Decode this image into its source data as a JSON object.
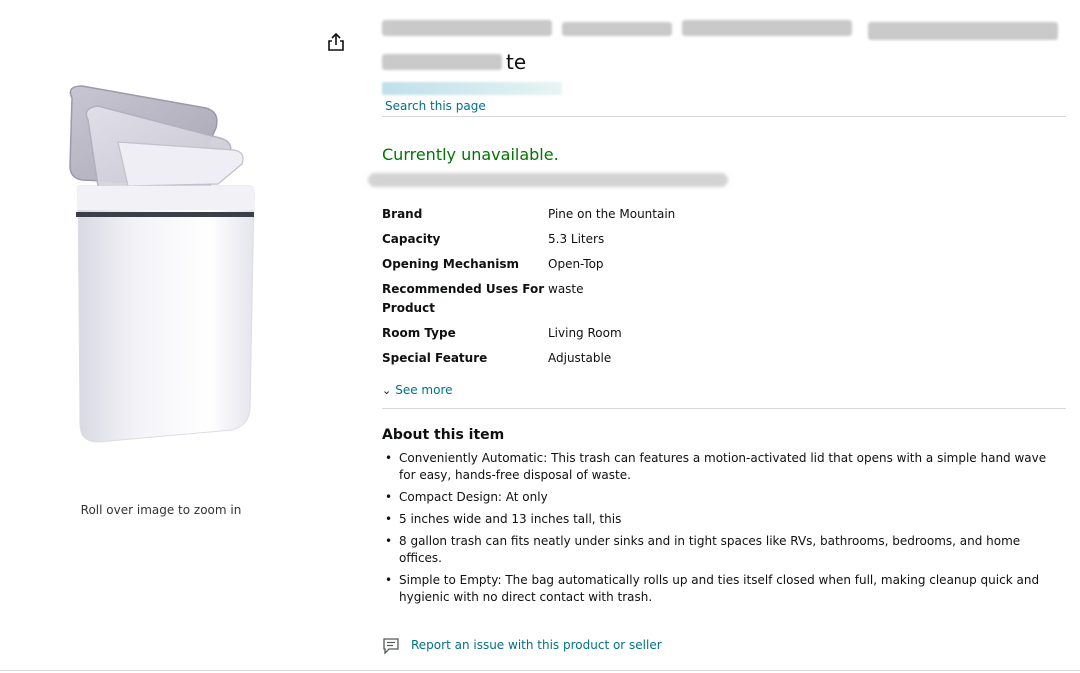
{
  "product": {
    "title_visible_fragment": "te",
    "image_alt": "White motion-sensor trash can with lid open",
    "zoom_hint": "Roll over image to zoom in"
  },
  "header": {
    "search_link": "Search this page"
  },
  "availability": {
    "status": "Currently unavailable.",
    "color": "#007600"
  },
  "specs": [
    {
      "key": "Brand",
      "value": "Pine on the Mountain"
    },
    {
      "key": "Capacity",
      "value": "5.3 Liters"
    },
    {
      "key": "Opening Mechanism",
      "value": "Open-Top"
    },
    {
      "key": "Recommended Uses For Product",
      "value": "waste"
    },
    {
      "key": "Room Type",
      "value": "Living Room"
    },
    {
      "key": "Special Feature",
      "value": "Adjustable"
    }
  ],
  "see_more": "See more",
  "about": {
    "title": "About this item",
    "bullets": [
      "Conveniently Automatic: This trash can features a motion-activated lid that opens with a simple hand wave for easy, hands-free disposal of waste.",
      "Compact Design: At only",
      "5 inches wide and 13 inches tall, this",
      "8 gallon trash can fits neatly under sinks and in tight spaces like RVs, bathrooms, bedrooms, and home offices.",
      "Simple to Empty: The bag automatically rolls up and ties itself closed when full, making cleanup quick and hygienic with no direct contact with trash."
    ]
  },
  "report_link": "Report an issue with this product or seller",
  "icons": {
    "share": "share-icon",
    "chevron": "chevron-down-icon",
    "report": "report-flag-icon"
  },
  "colors": {
    "link": "#007185",
    "text": "#0f1111",
    "divider": "#d5d9d9"
  }
}
